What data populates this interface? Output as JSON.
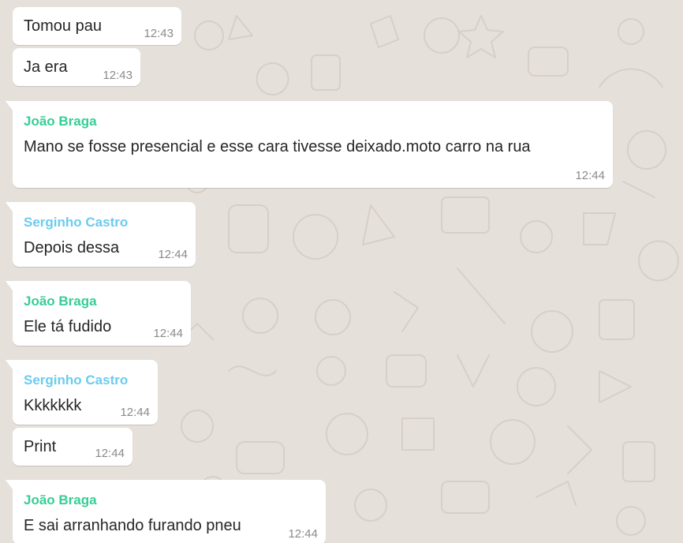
{
  "colors": {
    "background": "#e6e0db",
    "bubble": "#ffffff",
    "sender_joao": "#35cd96",
    "sender_serginho": "#6bcbef",
    "text": "#262626",
    "time": "#8a8a8a"
  },
  "messages": [
    {
      "sender": "",
      "text": "Tomou pau",
      "time": "12:43"
    },
    {
      "sender": "",
      "text": "Ja era",
      "time": "12:43"
    },
    {
      "sender": "João Braga",
      "text": "Mano se fosse presencial e esse cara tivesse deixado.moto carro na rua",
      "time": "12:44"
    },
    {
      "sender": "Serginho Castro",
      "text": "Depois dessa",
      "time": "12:44"
    },
    {
      "sender": "João Braga",
      "text": "Ele tá fudido",
      "time": "12:44"
    },
    {
      "sender": "Serginho Castro",
      "text": "Kkkkkkk",
      "time": "12:44"
    },
    {
      "sender": "",
      "text": "Print",
      "time": "12:44"
    },
    {
      "sender": "João Braga",
      "text": "E sai arranhando furando pneu",
      "time": "12:44"
    }
  ]
}
